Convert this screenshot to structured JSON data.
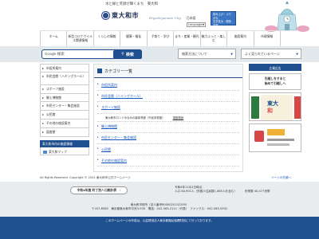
{
  "header": {
    "slogan": "水と緑と笑顔が輝くまち　東大和",
    "logo_text": "東大和市",
    "logo_roman": "Higashiyamato City",
    "lang_link": "日本語",
    "lang_select": "Language",
    "wave_line1": "読み上げ・ふりがな",
    "wave_line2": "文字拡大・配色変更",
    "wave_line3": "Web Wave Scanner"
  },
  "nav": {
    "items": [
      "ホーム",
      "新型コロナウイルス関連情報",
      "くらしの情報",
      "健康・福祉",
      "子育て・学び",
      "まち・産業・観光",
      "魅力ふっと・楽しむ",
      "施設案内",
      "市政情報"
    ]
  },
  "search": {
    "google_label": "Google 検索",
    "placeholder": "",
    "button_label": "検索",
    "purpose_button": "検索方法について",
    "faq_button": "よく見られているページ"
  },
  "sidebar": {
    "items": [
      "市役所案内",
      "市民会館（ハミングホール）",
      "スポーツ施設",
      "郷土博物館",
      "市民センター・集会施設",
      "公民館",
      "その他の施設案内",
      "図書館"
    ],
    "heading": "東大和市内の施設情報",
    "map_link": "東大和マップ"
  },
  "main": {
    "category_title": "カテゴリー一覧",
    "links": [
      "市役所案内",
      "市民会館（ハミングホール）",
      "スポーツ施設",
      "郷土博物館",
      "市民センター・集会施設",
      "公民館",
      "その他の施設案内"
    ],
    "sub_items": [
      "東大和市ロンドみなみの森体育館（市民体育館）",
      "運動施設"
    ]
  },
  "right": {
    "heading": "企業広告",
    "box_line1": "引越しをすると",
    "box_line2": "始めて引越しへ",
    "ad_text1": "東大",
    "ad_text2": "和"
  },
  "footer": {
    "copyright": "All Rights Reserved. Copyright © 2022 東大和市公式ホームページ",
    "pagetop": "ページの先頭へ",
    "button": "令和4年度 町丁別人口統計表",
    "info_date": "令和4年11月1日時点",
    "population": "人口 84,901人（外国人住民数1,865人を含む）",
    "households": "世帯数 40,477世帯",
    "addr_line1": "東大和市役所（法人番号8000020132209）",
    "addr_line2": "〒207-8585　東京都東大和市中央3-930　電話：042-563-2111（代表）　ファックス：042-563-5932",
    "bottom": "このホームページの作成は、公益財団法人東京都福祉保健財団にて行っております。"
  }
}
